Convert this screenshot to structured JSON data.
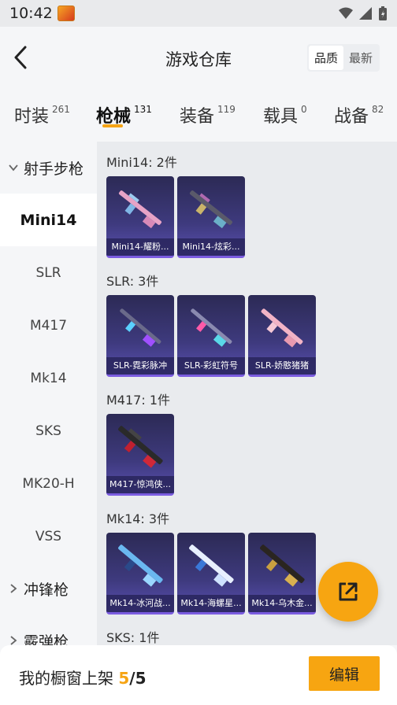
{
  "status": {
    "time": "10:42"
  },
  "header": {
    "title": "游戏仓库",
    "sort_options": [
      "品质",
      "最新"
    ],
    "sort_active": "品质"
  },
  "tabs": [
    {
      "label": "时装",
      "count": "261"
    },
    {
      "label": "枪械",
      "count": "131"
    },
    {
      "label": "装备",
      "count": "119"
    },
    {
      "label": "载具",
      "count": "0"
    },
    {
      "label": "战备",
      "count": "82"
    }
  ],
  "sidebar": {
    "group_expanded": "射手步枪",
    "items": [
      "Mini14",
      "SLR",
      "M417",
      "Mk14",
      "SKS",
      "MK20-H",
      "VSS"
    ],
    "group_collapsed": "冲锋枪",
    "group_partial": "霰弹枪"
  },
  "sections": [
    {
      "title": "Mini14: 2件",
      "cards": [
        {
          "caption": "Mini14-耀粉...",
          "skin": "pink-blue"
        },
        {
          "caption": "Mini14-炫彩...",
          "skin": "dark-multicolor"
        }
      ]
    },
    {
      "title": "SLR: 3件",
      "cards": [
        {
          "caption": "SLR-霓彩脉冲",
          "skin": "neon-pulse"
        },
        {
          "caption": "SLR-彩虹符号",
          "skin": "rainbow"
        },
        {
          "caption": "SLR-娇憨猪猪",
          "skin": "pink-pig"
        }
      ]
    },
    {
      "title": "M417: 1件",
      "cards": [
        {
          "caption": "M417-惊鸿侠...",
          "skin": "red-black"
        }
      ]
    },
    {
      "title": "Mk14: 3件",
      "cards": [
        {
          "caption": "Mk14-冰河战...",
          "skin": "ice-blue"
        },
        {
          "caption": "Mk14-海螺星...",
          "skin": "white-blue"
        },
        {
          "caption": "Mk14-乌木金...",
          "skin": "black-gold"
        }
      ]
    },
    {
      "title": "SKS: 1件",
      "cards": []
    }
  ],
  "bottom": {
    "shelf_label": "我的橱窗上架 ",
    "shelf_current": "5",
    "shelf_total": "/5",
    "edit_label": "编辑"
  },
  "colors": {
    "accent": "#f7a511",
    "card_bg": "#3e3a7e"
  }
}
